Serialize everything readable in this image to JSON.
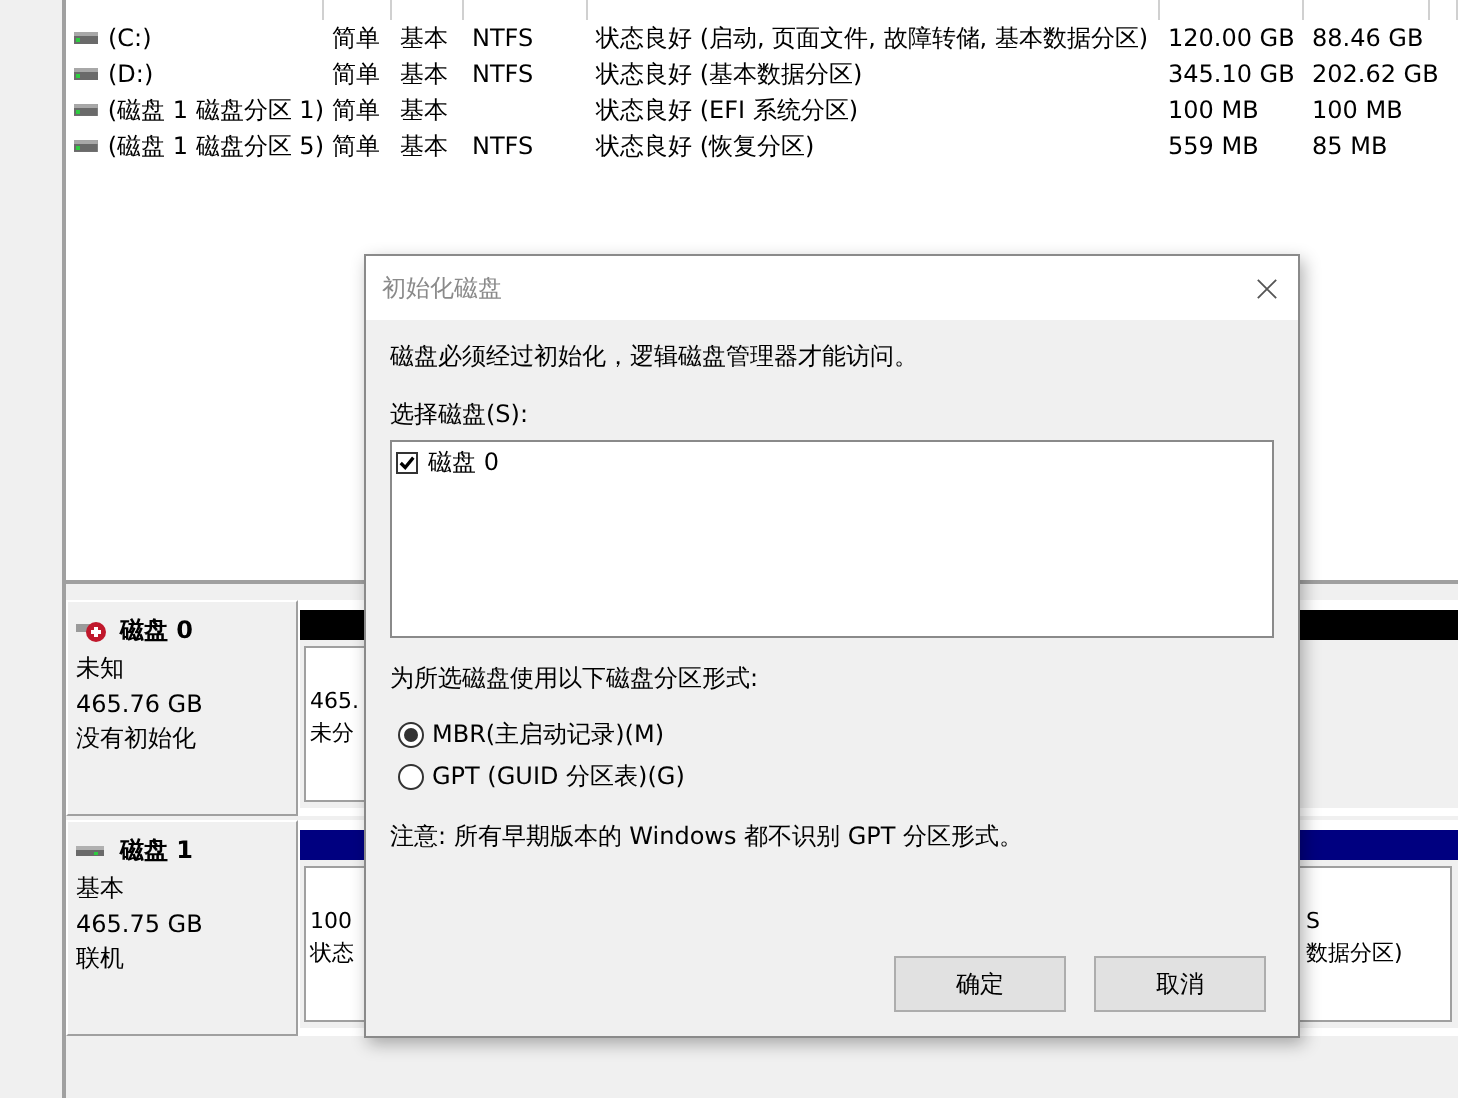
{
  "volumes": {
    "rows": [
      {
        "cells": [
          "(C:)",
          "简单",
          "基本",
          "NTFS",
          "状态良好 (启动, 页面文件, 故障转储, 基本数据分区)",
          "120.00 GB",
          "88.46 GB"
        ]
      },
      {
        "cells": [
          "(D:)",
          "简单",
          "基本",
          "NTFS",
          "状态良好 (基本数据分区)",
          "345.10 GB",
          "202.62 GB"
        ]
      },
      {
        "cells": [
          "(磁盘 1 磁盘分区 1)",
          "简单",
          "基本",
          "",
          "状态良好 (EFI 系统分区)",
          "100 MB",
          "100 MB"
        ]
      },
      {
        "cells": [
          "(磁盘 1 磁盘分区 5)",
          "简单",
          "基本",
          "NTFS",
          "状态良好 (恢复分区)",
          "559 MB",
          "85 MB"
        ]
      }
    ]
  },
  "disks": [
    {
      "name": "磁盘 0",
      "kind": "error",
      "type": "未知",
      "size": "465.76 GB",
      "state": "没有初始化",
      "color": "#000000",
      "partitions": [
        {
          "lines": [
            "465.",
            "未分"
          ]
        }
      ]
    },
    {
      "name": "磁盘 1",
      "kind": "online",
      "type": "基本",
      "size": "465.75 GB",
      "state": "联机",
      "color": "#000080",
      "partitions": [
        {
          "lines": [
            "100",
            "状态"
          ]
        },
        {
          "lines": [
            "S",
            "数据分区)"
          ]
        }
      ]
    }
  ],
  "dialog": {
    "title": "初始化磁盘",
    "message": "磁盘必须经过初始化，逻辑磁盘管理器才能访问。",
    "select_label": "选择磁盘(S):",
    "disks": [
      {
        "label": "磁盘 0",
        "checked": true
      }
    ],
    "style_label": "为所选磁盘使用以下磁盘分区形式:",
    "options": [
      {
        "label": "MBR(主启动记录)(M)",
        "selected": true
      },
      {
        "label": "GPT (GUID 分区表)(G)",
        "selected": false
      }
    ],
    "note": "注意: 所有早期版本的 Windows 都不识别 GPT 分区形式。",
    "buttons": [
      "确定",
      "取消"
    ]
  }
}
